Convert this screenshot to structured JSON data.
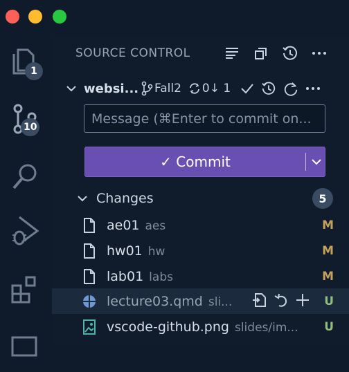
{
  "window": {
    "colors": {
      "close": "#fe5f57",
      "minimize": "#febc2e",
      "zoom": "#28c840"
    }
  },
  "activity_bar": [
    {
      "icon": "files-icon",
      "badge": "1"
    },
    {
      "icon": "source-control-icon",
      "badge": "10"
    },
    {
      "icon": "search-icon"
    },
    {
      "icon": "run-debug-icon"
    },
    {
      "icon": "extensions-icon"
    }
  ],
  "panel": {
    "title": "SOURCE CONTROL",
    "repo": {
      "name": "websi...",
      "branch": "Fall2",
      "sync": "0↓ 1"
    },
    "message": {
      "placeholder": "Message (⌘Enter to commit on..."
    },
    "commit": {
      "label": "✓ Commit"
    },
    "changes": {
      "label": "Changes",
      "count": "5",
      "files": [
        {
          "name": "ae01",
          "dir": "aes",
          "status": "M",
          "icon": "file-icon"
        },
        {
          "name": "hw01",
          "dir": "hw",
          "status": "M",
          "icon": "file-icon"
        },
        {
          "name": "lab01",
          "dir": "labs",
          "status": "M",
          "icon": "file-icon"
        },
        {
          "name": "lecture03.qmd",
          "dir": "sli...",
          "status": "U",
          "icon": "quarto-file-icon"
        },
        {
          "name": "vscode-github.png",
          "dir": "slides/im...",
          "status": "U",
          "icon": "image-file-icon"
        }
      ]
    }
  }
}
